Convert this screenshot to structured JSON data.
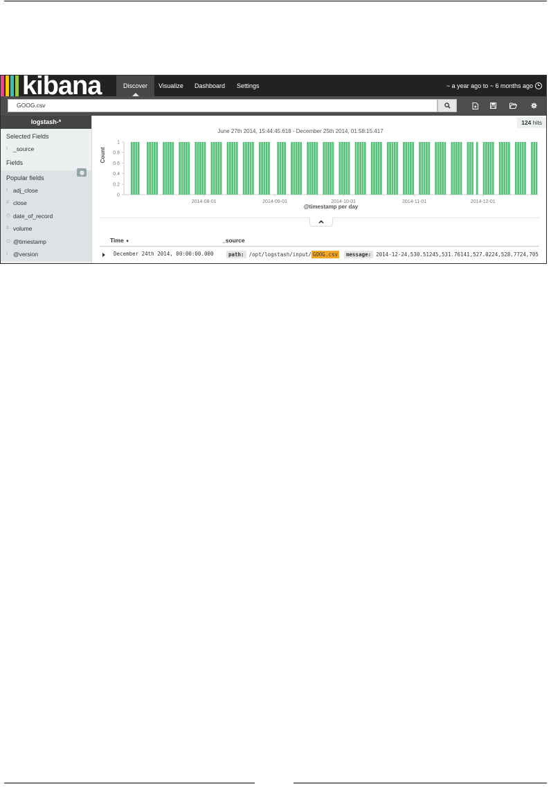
{
  "nav": {
    "logo_text": "kibana",
    "logo_colors": [
      "#e8488b",
      "#fec514",
      "#3ebeb0",
      "#9acd32"
    ],
    "tabs": [
      {
        "label": "Discover",
        "active": true
      },
      {
        "label": "Visualize",
        "active": false
      },
      {
        "label": "Dashboard",
        "active": false
      },
      {
        "label": "Settings",
        "active": false
      }
    ],
    "time_range": "~ a year ago to ~ 6 months ago",
    "time_icon": "clock-icon"
  },
  "search": {
    "query": "GOOG.csv",
    "search_icon": "search-icon",
    "tools": [
      "new-search-icon",
      "save-icon",
      "open-folder-icon",
      "gear-icon"
    ]
  },
  "sidebar": {
    "index_pattern": "logstash-*",
    "selected_heading": "Selected Fields",
    "selected_fields": [
      {
        "type": "t",
        "name": "_source"
      }
    ],
    "fields_heading": "Fields",
    "popular_heading": "Popular fields",
    "popular_fields": [
      {
        "type": "t",
        "name": "adj_close"
      },
      {
        "type": "#",
        "name": "close"
      },
      {
        "type": "clock",
        "name": "date_of_record"
      },
      {
        "type": "#",
        "name": "volume"
      },
      {
        "type": "clock",
        "name": "@timestamp"
      },
      {
        "type": "t",
        "name": "@version"
      }
    ]
  },
  "hits": {
    "count": "124",
    "label": "hits"
  },
  "chart_data": {
    "type": "bar",
    "title": "June 27th 2014, 15:44:45.618 - December 25th 2014, 01:58:15.417",
    "xlabel": "@timestamp per day",
    "ylabel": "Count",
    "ylim": [
      0,
      1
    ],
    "yticks": [
      "0",
      "0.2",
      "0.4",
      "0.6",
      "0.8",
      "1"
    ],
    "xticks": [
      "2014-08-01",
      "2014-09-01",
      "2014-10-01",
      "2014-11-01",
      "2014-12-01"
    ],
    "x_start": "2014-06-27",
    "x_end": "2014-12-25",
    "bar_color": "#57c17b",
    "value": 1,
    "dates": [
      "2014-06-30",
      "2014-07-01",
      "2014-07-02",
      "2014-07-03",
      "2014-07-07",
      "2014-07-08",
      "2014-07-09",
      "2014-07-10",
      "2014-07-11",
      "2014-07-14",
      "2014-07-15",
      "2014-07-16",
      "2014-07-17",
      "2014-07-18",
      "2014-07-21",
      "2014-07-22",
      "2014-07-23",
      "2014-07-24",
      "2014-07-25",
      "2014-07-28",
      "2014-07-29",
      "2014-07-30",
      "2014-07-31",
      "2014-08-01",
      "2014-08-04",
      "2014-08-05",
      "2014-08-06",
      "2014-08-07",
      "2014-08-08",
      "2014-08-11",
      "2014-08-12",
      "2014-08-13",
      "2014-08-14",
      "2014-08-15",
      "2014-08-18",
      "2014-08-19",
      "2014-08-20",
      "2014-08-21",
      "2014-08-22",
      "2014-08-25",
      "2014-08-26",
      "2014-08-27",
      "2014-08-28",
      "2014-08-29",
      "2014-09-02",
      "2014-09-03",
      "2014-09-04",
      "2014-09-05",
      "2014-09-08",
      "2014-09-09",
      "2014-09-10",
      "2014-09-11",
      "2014-09-12",
      "2014-09-15",
      "2014-09-16",
      "2014-09-17",
      "2014-09-18",
      "2014-09-19",
      "2014-09-22",
      "2014-09-23",
      "2014-09-24",
      "2014-09-25",
      "2014-09-26",
      "2014-09-29",
      "2014-09-30",
      "2014-10-01",
      "2014-10-02",
      "2014-10-03",
      "2014-10-06",
      "2014-10-07",
      "2014-10-08",
      "2014-10-09",
      "2014-10-10",
      "2014-10-13",
      "2014-10-14",
      "2014-10-15",
      "2014-10-16",
      "2014-10-17",
      "2014-10-20",
      "2014-10-21",
      "2014-10-22",
      "2014-10-23",
      "2014-10-24",
      "2014-10-27",
      "2014-10-28",
      "2014-10-29",
      "2014-10-30",
      "2014-10-31",
      "2014-11-03",
      "2014-11-04",
      "2014-11-05",
      "2014-11-06",
      "2014-11-07",
      "2014-11-10",
      "2014-11-11",
      "2014-11-12",
      "2014-11-13",
      "2014-11-14",
      "2014-11-17",
      "2014-11-18",
      "2014-11-19",
      "2014-11-20",
      "2014-11-21",
      "2014-11-24",
      "2014-11-25",
      "2014-11-26",
      "2014-11-28",
      "2014-12-01",
      "2014-12-02",
      "2014-12-03",
      "2014-12-04",
      "2014-12-05",
      "2014-12-08",
      "2014-12-09",
      "2014-12-10",
      "2014-12-11",
      "2014-12-12",
      "2014-12-15",
      "2014-12-16",
      "2014-12-17",
      "2014-12-18",
      "2014-12-19",
      "2014-12-22",
      "2014-12-23",
      "2014-12-24"
    ]
  },
  "table": {
    "columns": [
      "Time",
      "_source"
    ],
    "sort_icon": "caret-down-icon",
    "rows": [
      {
        "time": "December 24th 2014, 00:00:00.000",
        "path_key": "path:",
        "path_prefix": "/opt/logstash/input/",
        "path_highlight": "GOOG.csv",
        "message_key": "message:",
        "message_value": "2014-12-24,530.51245,531.76141,527.0224,528.7724,705"
      }
    ]
  }
}
